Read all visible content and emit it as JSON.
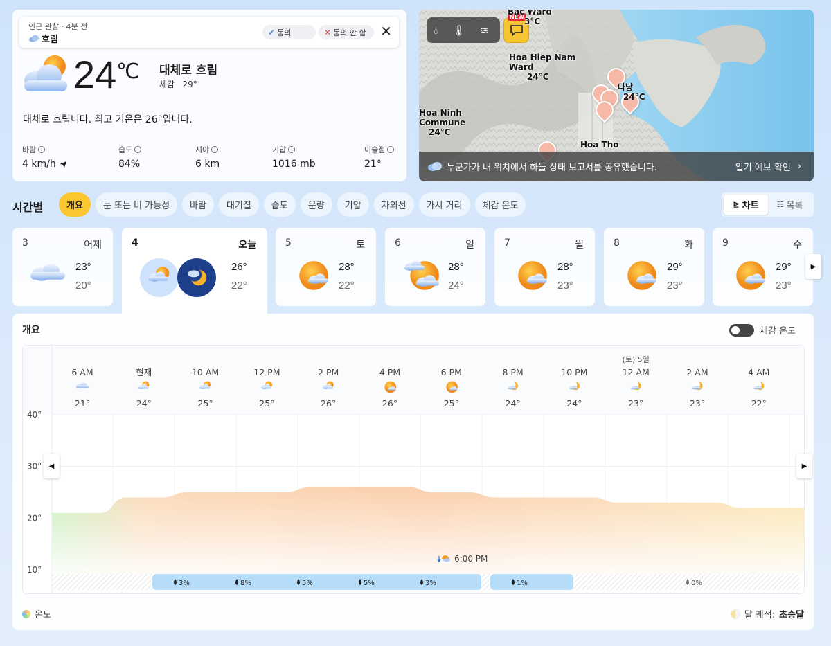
{
  "current": {
    "observation": {
      "meta": "인근 관찰 · 4분 전",
      "condition": "흐림",
      "agree_label": "동의",
      "disagree_label": "동의 안 함"
    },
    "temp": "24",
    "unit": "℃",
    "condition": "대체로 흐림",
    "feels_label": "체감",
    "feels_value": "29°",
    "summary": "대체로 흐립니다. 최고 기온은 26°입니다.",
    "stats": [
      {
        "label": "바람",
        "value": "4 km/h"
      },
      {
        "label": "습도",
        "value": "84%"
      },
      {
        "label": "시야",
        "value": "6 km"
      },
      {
        "label": "기압",
        "value": "1016 mb"
      },
      {
        "label": "이슬점",
        "value": "21°"
      }
    ]
  },
  "map": {
    "new_badge": "NEW",
    "labels": [
      {
        "name": "Bac Ward",
        "temp": "3°C"
      },
      {
        "name": "Hoa Hiep Nam Ward",
        "temp": "24°C"
      },
      {
        "name": "다낭",
        "temp": "24°C"
      },
      {
        "name": "Hoa Ninh Commune",
        "temp": "24°C"
      },
      {
        "name": "Hoa Tho",
        "temp": ""
      }
    ],
    "banner": "누군가가 내 위치에서 하늘 상태 보고서를 공유했습니다.",
    "banner_link": "일기 예보 확인"
  },
  "hourly_section": {
    "title": "시간별",
    "tabs": [
      "개요",
      "눈 또는 비 가능성",
      "바람",
      "대기질",
      "습도",
      "운량",
      "기압",
      "자외선",
      "가시 거리",
      "체감 온도"
    ],
    "active_tab": 0,
    "view_chart": "차트",
    "view_list": "목록"
  },
  "days": [
    {
      "num": "3",
      "name": "어제",
      "hi": "23°",
      "lo": "20°",
      "icon": "cloudy"
    },
    {
      "num": "4",
      "name": "오늘",
      "hi": "26°",
      "lo": "22°",
      "icon": "partly-cloudy-day-night"
    },
    {
      "num": "5",
      "name": "토",
      "hi": "28°",
      "lo": "22°",
      "icon": "partly-sunny"
    },
    {
      "num": "6",
      "name": "일",
      "hi": "28°",
      "lo": "24°",
      "icon": "mostly-cloudy"
    },
    {
      "num": "7",
      "name": "월",
      "hi": "28°",
      "lo": "23°",
      "icon": "partly-sunny"
    },
    {
      "num": "8",
      "name": "화",
      "hi": "29°",
      "lo": "23°",
      "icon": "partly-sunny"
    },
    {
      "num": "9",
      "name": "수",
      "hi": "29°",
      "lo": "23°",
      "icon": "partly-sunny"
    }
  ],
  "overview": {
    "title": "개요",
    "feels_toggle_label": "체감 온도",
    "footer_left": "온도",
    "moon_label": "달 궤적:",
    "moon_value": "초승달",
    "sunset_label": "6:00 PM"
  },
  "chart_data": {
    "type": "area",
    "y_ticks": [
      "40°",
      "30°",
      "20°",
      "10°"
    ],
    "ylim": [
      10,
      40
    ],
    "hours": [
      {
        "label": "6 AM",
        "sub": "",
        "temp": "21°",
        "icon": "cloudy"
      },
      {
        "label": "현재",
        "sub": "",
        "temp": "24°",
        "icon": "partly-cloudy"
      },
      {
        "label": "10 AM",
        "sub": "",
        "temp": "25°",
        "icon": "partly-cloudy"
      },
      {
        "label": "12 PM",
        "sub": "",
        "temp": "25°",
        "icon": "partly-cloudy"
      },
      {
        "label": "2 PM",
        "sub": "",
        "temp": "26°",
        "icon": "partly-cloudy"
      },
      {
        "label": "4 PM",
        "sub": "",
        "temp": "26°",
        "icon": "partly-sunny"
      },
      {
        "label": "6 PM",
        "sub": "",
        "temp": "25°",
        "icon": "partly-sunny"
      },
      {
        "label": "8 PM",
        "sub": "",
        "temp": "24°",
        "icon": "partly-cloudy-night"
      },
      {
        "label": "10 PM",
        "sub": "",
        "temp": "24°",
        "icon": "partly-cloudy-night"
      },
      {
        "label": "12 AM",
        "sub": "(토) 5일",
        "temp": "23°",
        "icon": "partly-cloudy-night"
      },
      {
        "label": "2 AM",
        "sub": "",
        "temp": "23°",
        "icon": "partly-cloudy-night"
      },
      {
        "label": "4 AM",
        "sub": "",
        "temp": "22°",
        "icon": "partly-cloudy-night"
      }
    ],
    "temps": [
      21,
      24,
      25,
      25,
      26,
      26,
      25,
      24,
      24,
      23,
      23,
      22
    ],
    "precip": [
      "3%",
      "8%",
      "5%",
      "5%",
      "3%",
      "1%",
      "0%"
    ]
  }
}
